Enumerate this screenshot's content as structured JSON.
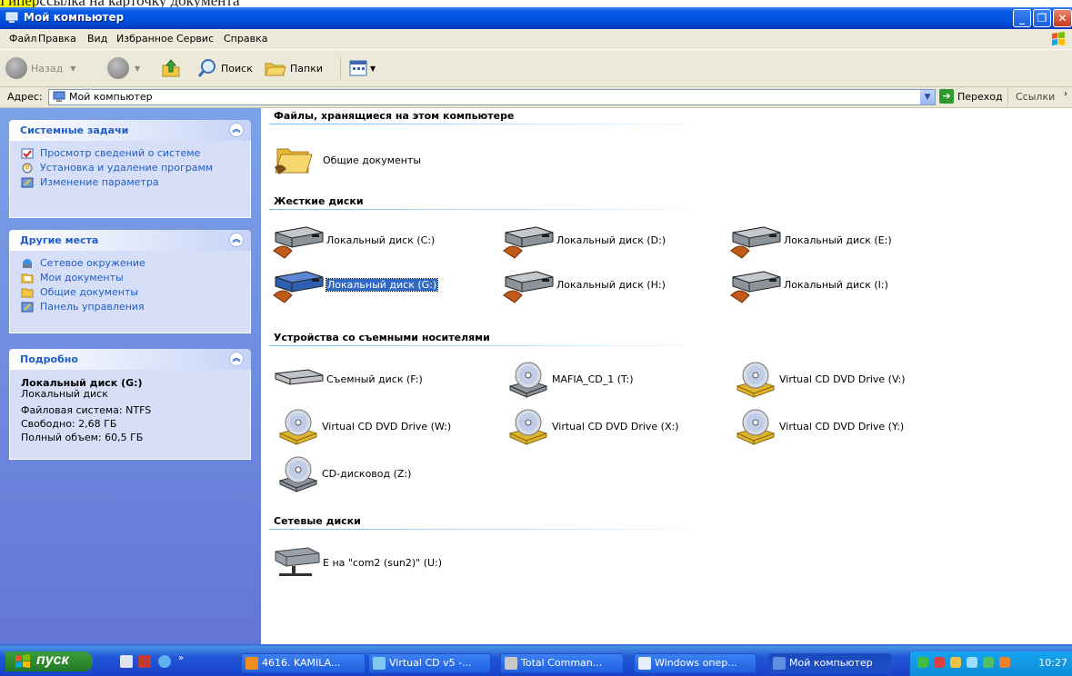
{
  "caption": "Гиперссылка на карточку документа",
  "window": {
    "title": "Мой компьютер"
  },
  "menu": [
    "Файл",
    "Правка",
    "Вид",
    "Избранное",
    "Сервис",
    "Справка"
  ],
  "toolbar": {
    "back": "Назад",
    "search": "Поиск",
    "folders": "Папки"
  },
  "address": {
    "label": "Адрес:",
    "value": "Мой компьютер",
    "go": "Переход",
    "links": "Ссылки"
  },
  "left": {
    "system_tasks": {
      "title": "Системные задачи",
      "items": [
        "Просмотр сведений о системе",
        "Установка и удаление программ",
        "Изменение параметра"
      ]
    },
    "other_places": {
      "title": "Другие места",
      "items": [
        "Сетевое окружение",
        "Мои документы",
        "Общие документы",
        "Панель управления"
      ]
    },
    "details": {
      "title": "Подробно",
      "name": "Локальный диск (G:)",
      "type": "Локальный диск",
      "fs": "Файловая система: NTFS",
      "free": "Свободно: 2,68 ГБ",
      "total": "Полный объем: 60,5 ГБ"
    }
  },
  "content": {
    "groups": {
      "stored": "Файлы, хранящиеся на этом компьютере",
      "hard": "Жесткие диски",
      "removable": "Устройства со съемными носителями",
      "network": "Сетевые диски"
    },
    "stored": [
      "Общие документы"
    ],
    "hard": [
      "Локальный диск (C:)",
      "Локальный диск (D:)",
      "Локальный диск (E:)",
      "Локальный диск (G:)",
      "Локальный диск (H:)",
      "Локальный диск (I:)"
    ],
    "removable": [
      "Съемный диск (F:)",
      "MAFIA_CD_1 (T:)",
      "Virtual CD DVD Drive (V:)",
      "Virtual CD DVD Drive (W:)",
      "Virtual CD DVD Drive (X:)",
      "Virtual CD DVD Drive (Y:)",
      "CD-дисковод (Z:)"
    ],
    "network": [
      "E на \"com2 (sun2)\" (U:)"
    ]
  },
  "taskbar": {
    "start": "пуск",
    "tasks": [
      "4616. KAMILA...",
      "Virtual CD v5 -...",
      "Total Comman...",
      "Windows опер...",
      "Мой компьютер"
    ],
    "clock": "10:27"
  },
  "colors": {
    "titlebar": "#0054e3",
    "taskpane_link": "#215dc6",
    "selection": "#316ac5",
    "taskbar": "#2157d7"
  }
}
